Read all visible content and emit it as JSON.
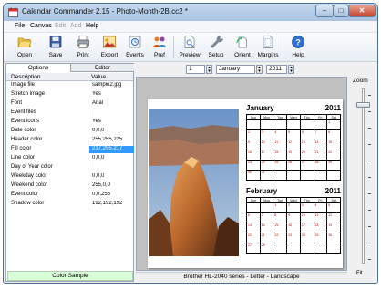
{
  "window": {
    "title": "Calendar Commander 2.15 - Photo-Month-2B.cc2 *",
    "minimize_glyph": "–",
    "maximize_glyph": "□",
    "close_glyph": "✕"
  },
  "menu": [
    "File",
    "Canvas",
    "Edit",
    "Add",
    "Help"
  ],
  "toolbar": {
    "buttons": [
      {
        "label": "Open",
        "icon": "folder-open-icon"
      },
      {
        "label": "Save",
        "icon": "floppy-disk-icon"
      },
      {
        "label": "Print",
        "icon": "printer-icon"
      },
      {
        "label": "Export",
        "icon": "export-image-icon"
      },
      {
        "label": "Events",
        "icon": "events-icon"
      },
      {
        "label": "Pref",
        "icon": "people-icon"
      },
      {
        "label": "Preview",
        "icon": "preview-page-icon"
      },
      {
        "label": "Setup",
        "icon": "wrench-icon"
      },
      {
        "label": "Orient",
        "icon": "rotate-page-icon"
      },
      {
        "label": "Margins",
        "icon": "margins-page-icon"
      },
      {
        "label": "Help",
        "icon": "help-icon"
      }
    ]
  },
  "left_panel": {
    "tabs": [
      "Options",
      "Editor"
    ],
    "columns": [
      "Description",
      "Value"
    ],
    "properties": [
      {
        "name": "Image file",
        "value": "sample2.jpg"
      },
      {
        "name": "Stretch image",
        "value": "Yes"
      },
      {
        "name": "Font",
        "value": "Arial"
      },
      {
        "name": "Event files",
        "value": ""
      },
      {
        "name": "Event icons",
        "value": "Yes"
      },
      {
        "name": "Date color",
        "value": "0,0,0"
      },
      {
        "name": "Header color",
        "value": "255,255,225"
      },
      {
        "name": "Fill color",
        "value": "217,255,217"
      },
      {
        "name": "Line color",
        "value": "0,0,0"
      },
      {
        "name": "Day of Year color",
        "value": ""
      },
      {
        "name": "Weekday color",
        "value": "0,0,0"
      },
      {
        "name": "Weekend color",
        "value": "255,0,0"
      },
      {
        "name": "Event color",
        "value": "0,0,255"
      },
      {
        "name": "Shadow color",
        "value": "192,192,192"
      }
    ],
    "selected_index": 7,
    "color_sample_label": "Color Sample",
    "color_sample_color": "#d9ffd9"
  },
  "controls": {
    "months_count": "1",
    "start_month": "January",
    "start_year": "2011"
  },
  "calendar": {
    "weekday_headers": [
      "Sun",
      "Mon",
      "Tue",
      "Wed",
      "Thu",
      "Fri",
      "Sat"
    ],
    "months": [
      {
        "name": "January",
        "year": "2011",
        "weeks": [
          [
            "",
            "",
            "",
            "",
            "",
            "",
            "1"
          ],
          [
            "2",
            "3",
            "4",
            "5",
            "6",
            "7",
            "8"
          ],
          [
            "9",
            "10",
            "11",
            "12",
            "13",
            "14",
            "15"
          ],
          [
            "16",
            "17",
            "18",
            "19",
            "20",
            "21",
            "22"
          ],
          [
            "23",
            "24",
            "25",
            "26",
            "27",
            "28",
            "29"
          ],
          [
            "30",
            "31",
            "",
            "",
            "",
            "",
            ""
          ]
        ]
      },
      {
        "name": "February",
        "year": "2011",
        "weeks": [
          [
            "",
            "",
            "1",
            "2",
            "3",
            "4",
            "5"
          ],
          [
            "6",
            "7",
            "8",
            "9",
            "10",
            "11",
            "12"
          ],
          [
            "13",
            "14",
            "15",
            "16",
            "17",
            "18",
            "19"
          ],
          [
            "20",
            "21",
            "22",
            "23",
            "24",
            "25",
            "26"
          ],
          [
            "27",
            "28",
            "",
            "",
            "",
            "",
            ""
          ]
        ]
      }
    ]
  },
  "zoom": {
    "label": "Zoom",
    "fit_label": "Fit",
    "level": 0.08
  },
  "status": {
    "printer": "Brother HL-2040 series - Letter - Landscape"
  },
  "colors": {
    "title_bar": "#b6cee8",
    "close_button": "#c4412b",
    "selection": "#3399ff",
    "weekend_text": "#c00000"
  }
}
